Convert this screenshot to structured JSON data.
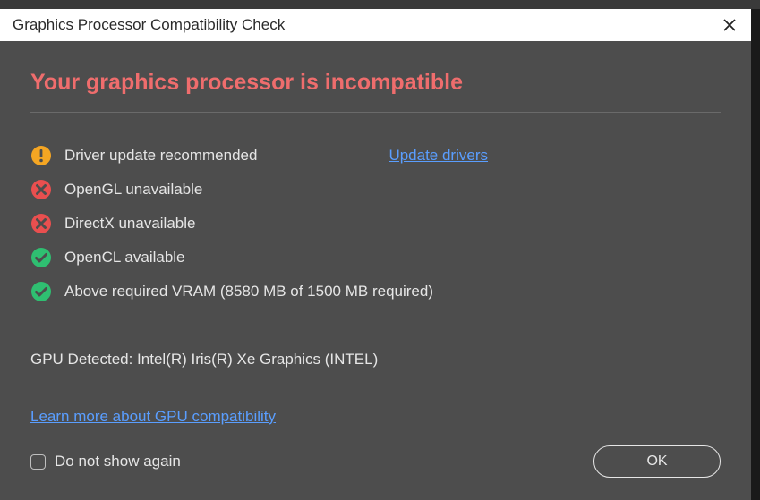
{
  "titlebar": {
    "title": "Graphics Processor Compatibility Check"
  },
  "heading": "Your graphics processor is incompatible",
  "checks": [
    {
      "status": "warning",
      "label": "Driver update recommended",
      "link": "Update drivers"
    },
    {
      "status": "error",
      "label": "OpenGL unavailable"
    },
    {
      "status": "error",
      "label": "DirectX unavailable"
    },
    {
      "status": "ok",
      "label": "OpenCL available"
    },
    {
      "status": "ok",
      "label": "Above required VRAM (8580 MB of 1500 MB required)"
    }
  ],
  "gpu_detected": "GPU Detected: Intel(R) Iris(R) Xe Graphics (INTEL)",
  "learn_more": "Learn more about GPU compatibility",
  "do_not_show": "Do not show again",
  "ok_button": "OK",
  "colors": {
    "warning": "#f5a623",
    "error": "#e94f4f",
    "ok": "#2fbf71"
  }
}
